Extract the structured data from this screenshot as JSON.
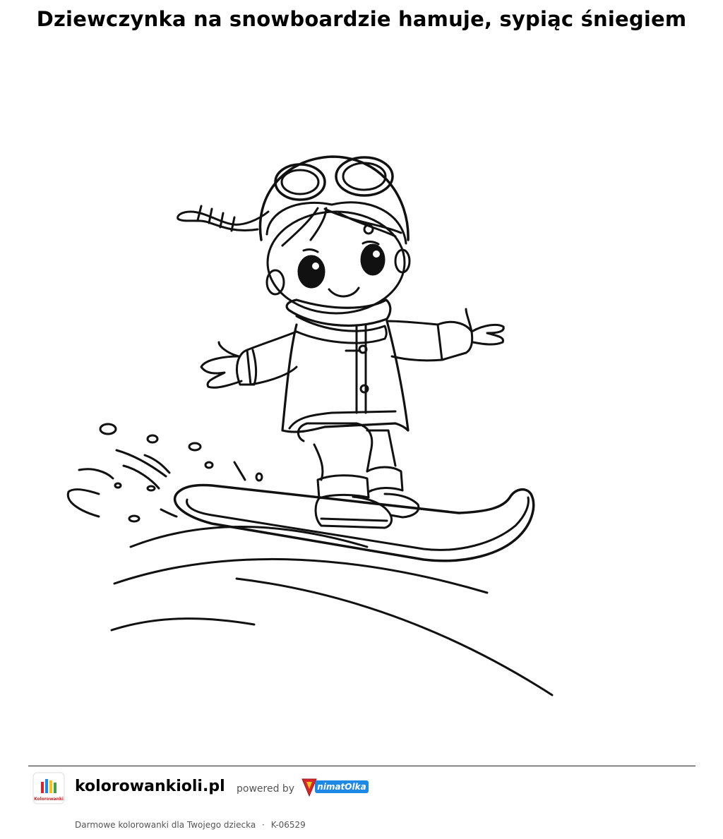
{
  "page": {
    "title": "Dziewczynka na snowboardzie hamuje, sypiąc śniegiem"
  },
  "illustration": {
    "subject": "girl-on-snowboard-coloring-page"
  },
  "footer": {
    "site_name": "kolorowankioli.pl",
    "powered_by": "powered by",
    "brand_logo_text": "AnimatOlka",
    "site_logo_text": "KolorowankiOli",
    "tagline": "Darmowe kolorowanki dla Twojego dziecka",
    "separator": "·",
    "code": "K-06529"
  },
  "colors": {
    "line": "#111111",
    "brand_red": "#d7262b",
    "brand_blue": "#1e88e5",
    "brand_yellow": "#f5c21b"
  }
}
